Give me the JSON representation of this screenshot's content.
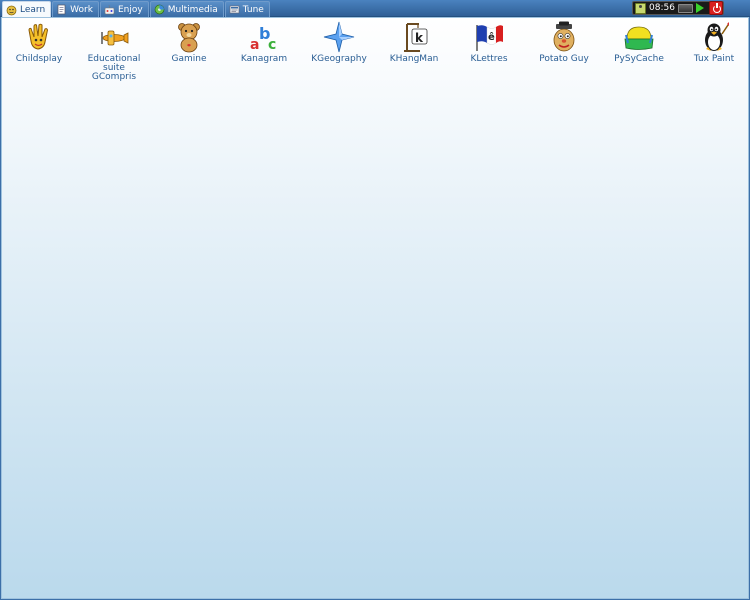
{
  "tabs": [
    {
      "label": "Learn",
      "icon": "learn-icon",
      "active": true
    },
    {
      "label": "Work",
      "icon": "work-icon",
      "active": false
    },
    {
      "label": "Enjoy",
      "icon": "enjoy-icon",
      "active": false
    },
    {
      "label": "Multimedia",
      "icon": "multimedia-icon",
      "active": false
    },
    {
      "label": "Tune",
      "icon": "tune-icon",
      "active": false
    }
  ],
  "tray": {
    "clock": "08:56",
    "icons": [
      "user-icon",
      "network-icon",
      "play-icon"
    ],
    "power_icon": "power-icon"
  },
  "apps": [
    {
      "label": "Childsplay",
      "icon": "childsplay-hand-icon"
    },
    {
      "label": "Educational\nsuite\nGCompris",
      "icon": "gcompris-airplane-icon"
    },
    {
      "label": "Gamine",
      "icon": "gamine-teddy-bear-icon"
    },
    {
      "label": "Kanagram",
      "icon": "kanagram-abc-icon"
    },
    {
      "label": "KGeography",
      "icon": "kgeography-compass-star-icon"
    },
    {
      "label": "KHangMan",
      "icon": "khangman-gallows-icon"
    },
    {
      "label": "KLettres",
      "icon": "klettres-flag-icon"
    },
    {
      "label": "Potato Guy",
      "icon": "potato-guy-icon"
    },
    {
      "label": "PySyCache",
      "icon": "pysycache-icon"
    },
    {
      "label": "Tux Paint",
      "icon": "tux-paint-penguin-icon"
    }
  ],
  "colors": {
    "panel": "#3c6fa8",
    "label": "#2a5e94",
    "desktop_top": "#ffffff",
    "desktop_bottom": "#bad9ec"
  }
}
